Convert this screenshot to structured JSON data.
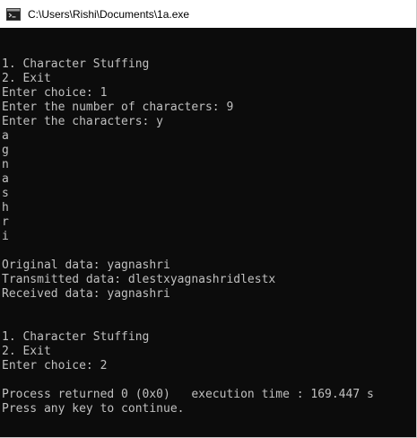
{
  "window": {
    "title": "C:\\Users\\Rishi\\Documents\\1a.exe"
  },
  "console": {
    "lines": [
      "1. Character Stuffing",
      "2. Exit",
      "Enter choice: 1",
      "Enter the number of characters: 9",
      "Enter the characters: y",
      "a",
      "g",
      "n",
      "a",
      "s",
      "h",
      "r",
      "i",
      "",
      "Original data: yagnashri",
      "Transmitted data: dlestxyagnashridlestx",
      "Received data: yagnashri",
      "",
      "",
      "1. Character Stuffing",
      "2. Exit",
      "Enter choice: 2",
      "",
      "Process returned 0 (0x0)   execution time : 169.447 s",
      "Press any key to continue."
    ]
  },
  "colors": {
    "console_background": "#0c0c0c",
    "console_text": "#c0c0c0",
    "titlebar_background": "#ffffff"
  },
  "icons": {
    "app_icon": "console-app-icon"
  }
}
